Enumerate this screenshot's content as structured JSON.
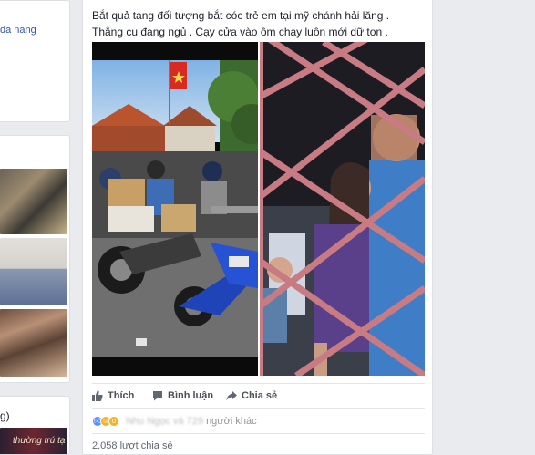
{
  "left": {
    "location_text": "da nang",
    "group_label": "g)",
    "banner_text": "thường trú tạ"
  },
  "post": {
    "line1": "Bắt quả tang đối tượng bắt cóc trẻ em tại mỹ chánh hải lăng .",
    "line2": "Thằng cu đang ngủ . Cạy cửa vào ôm chạy luôn mới dữ ton ."
  },
  "actions": {
    "like_label": "Thích",
    "comment_label": "Bình luận",
    "share_label": "Chia sẻ"
  },
  "reactions": {
    "names_blurred": "Nhu Ngọc và 729",
    "others_label": "người khác",
    "icons": [
      "like",
      "haha",
      "wow"
    ]
  },
  "shares": {
    "label": "2.058 lượt chia sẻ"
  },
  "colors": {
    "page_bg": "#e9ebee",
    "link": "#365899",
    "like_blue": "#5890ff",
    "secondary_text": "#90949c"
  }
}
